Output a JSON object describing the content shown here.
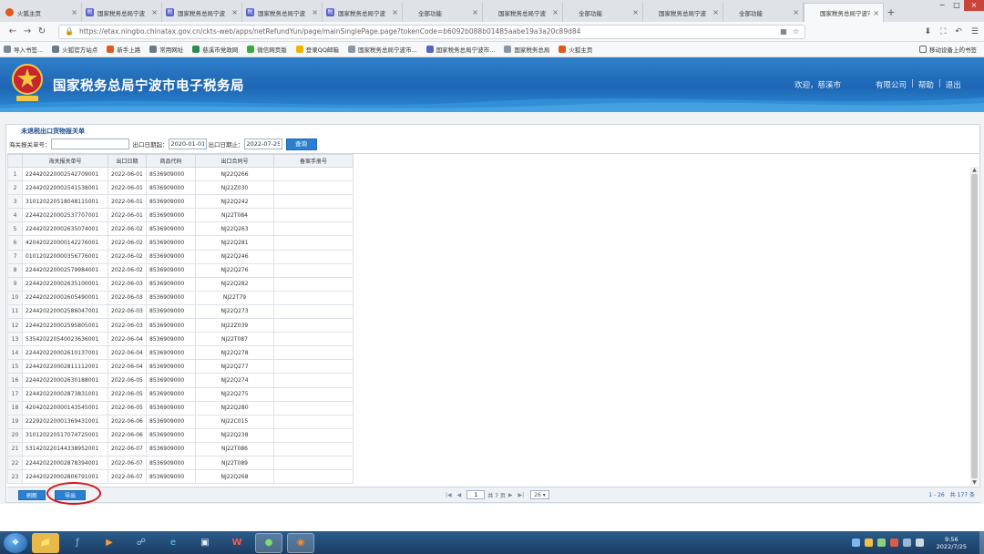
{
  "browser": {
    "tabs": [
      {
        "label": "火狐主页",
        "icon": "fox",
        "active": false
      },
      {
        "label": "国家税务总局宁波",
        "icon": "tax",
        "active": false
      },
      {
        "label": "国家税务总局宁波",
        "icon": "tax",
        "active": false
      },
      {
        "label": "国家税务总局宁波",
        "icon": "tax",
        "active": false
      },
      {
        "label": "国家税务总局宁波",
        "icon": "tax",
        "active": false
      },
      {
        "label": "全部功能",
        "icon": "blank",
        "active": false
      },
      {
        "label": "国家税务总局宁波",
        "icon": "blank",
        "active": false
      },
      {
        "label": "全部功能",
        "icon": "blank",
        "active": false
      },
      {
        "label": "国家税务总局宁波",
        "icon": "blank",
        "active": false
      },
      {
        "label": "全部功能",
        "icon": "blank",
        "active": false
      },
      {
        "label": "国家税务总局宁波市电",
        "icon": "blank",
        "active": true
      }
    ],
    "url": "https://etax.ningbo.chinatax.gov.cn/ckts-web/apps/netRefundYun/page/mainSinglePage.page?tokenCode=b6092b088b01485aabe19a3a20c89d84",
    "bookmarks": [
      "导入书签...",
      "火狐官方站点",
      "新手上路",
      "常用网址",
      "慈溪市党政网",
      "微信网页版",
      "登录QQ邮箱",
      "国家税务总局宁波市...",
      "国家税务总局宁波市...",
      "国家税务总局",
      "火狐主页"
    ],
    "bookmark_right": "移动设备上的书签"
  },
  "header": {
    "site_title": "国家税务总局宁波市电子税务局",
    "welcome": "欢迎，慈溪市",
    "links": [
      "有限公司",
      "帮助",
      "退出"
    ]
  },
  "panel": {
    "title": "未退税出口货物报关单",
    "filter": {
      "customs_no_label": "海关报关单号：",
      "customs_no_value": "",
      "date_start_label": "出口日期起：",
      "date_start_value": "2020-01-01",
      "date_end_label": "出口日期止：",
      "date_end_value": "2022-07-25",
      "search_label": "查询"
    },
    "columns": [
      "海关报关单号",
      "出口日期",
      "商品代码",
      "出口合同号",
      "备案手册号"
    ],
    "rows": [
      [
        "1",
        "224420220002542709001",
        "2022-06-01",
        "8536909000",
        "NJ22Q266",
        ""
      ],
      [
        "2",
        "224420220002541538001",
        "2022-06-01",
        "8536909000",
        "NJ22Z030",
        ""
      ],
      [
        "3",
        "310120220518048115001",
        "2022-06-01",
        "8536909000",
        "NJ22Q242",
        ""
      ],
      [
        "4",
        "224420220002537707001",
        "2022-06-01",
        "8536909000",
        "NJ22T084",
        ""
      ],
      [
        "5",
        "224420220002635074001",
        "2022-06-02",
        "8536909000",
        "NJ22Q263",
        ""
      ],
      [
        "6",
        "420420220000142276001",
        "2022-06-02",
        "8536909000",
        "NJ22Q281",
        ""
      ],
      [
        "7",
        "010120220000356776001",
        "2022-06-02",
        "8536909000",
        "NJ22Q246",
        ""
      ],
      [
        "8",
        "224420220002579984001",
        "2022-06-02",
        "8536909000",
        "NJ22Q276",
        ""
      ],
      [
        "9",
        "224420220002635100001",
        "2022-06-03",
        "8536909000",
        "NJ22Q282",
        ""
      ],
      [
        "10",
        "224420220002605490001",
        "2022-06-03",
        "8536909000",
        "NJ22T79",
        ""
      ],
      [
        "11",
        "224420220002586047001",
        "2022-06-03",
        "8536909000",
        "NJ22Q273",
        ""
      ],
      [
        "12",
        "224420220002595805001",
        "2022-06-03",
        "8536909000",
        "NJ22Z039",
        ""
      ],
      [
        "13",
        "535420220540023636001",
        "2022-06-04",
        "8536909000",
        "NJ22T087",
        ""
      ],
      [
        "14",
        "224420220002610137001",
        "2022-06-04",
        "8536909000",
        "NJ22Q278",
        ""
      ],
      [
        "15",
        "224420220002811112001",
        "2022-06-04",
        "8536909000",
        "NJ22Q277",
        ""
      ],
      [
        "16",
        "224420220002630188001",
        "2022-06-05",
        "8536909000",
        "NJ22Q274",
        ""
      ],
      [
        "17",
        "224420220002873831001",
        "2022-06-05",
        "8536909000",
        "NJ22Q275",
        ""
      ],
      [
        "18",
        "420420220000143545001",
        "2022-06-05",
        "8536909000",
        "NJ22Q280",
        ""
      ],
      [
        "19",
        "222920220001369431001",
        "2022-06-06",
        "8536909000",
        "NJ22C015",
        ""
      ],
      [
        "20",
        "310120220517074725001",
        "2022-06-06",
        "8536909000",
        "NJ22Q238",
        ""
      ],
      [
        "21",
        "531420220144338952001",
        "2022-06-07",
        "8536909000",
        "NJ22T086",
        ""
      ],
      [
        "22",
        "224420220002878394001",
        "2022-06-07",
        "8536909000",
        "NJ22T089",
        ""
      ],
      [
        "23",
        "224420220002806791001",
        "2022-06-07",
        "8536909000",
        "NJ22Q268",
        ""
      ]
    ],
    "footer": {
      "buttons": [
        "刷新",
        "导出"
      ],
      "page_input": "1",
      "page_total_text": "共 7 页",
      "page_size": "26",
      "range_info": "1 - 26　共 177 条"
    }
  },
  "taskbar": {
    "clock_time": "9:56",
    "clock_date": "2022/7/25"
  },
  "colors": {
    "banner": "#1d66b5",
    "button": "#2a7fd0",
    "highlight": "#d6141b"
  }
}
